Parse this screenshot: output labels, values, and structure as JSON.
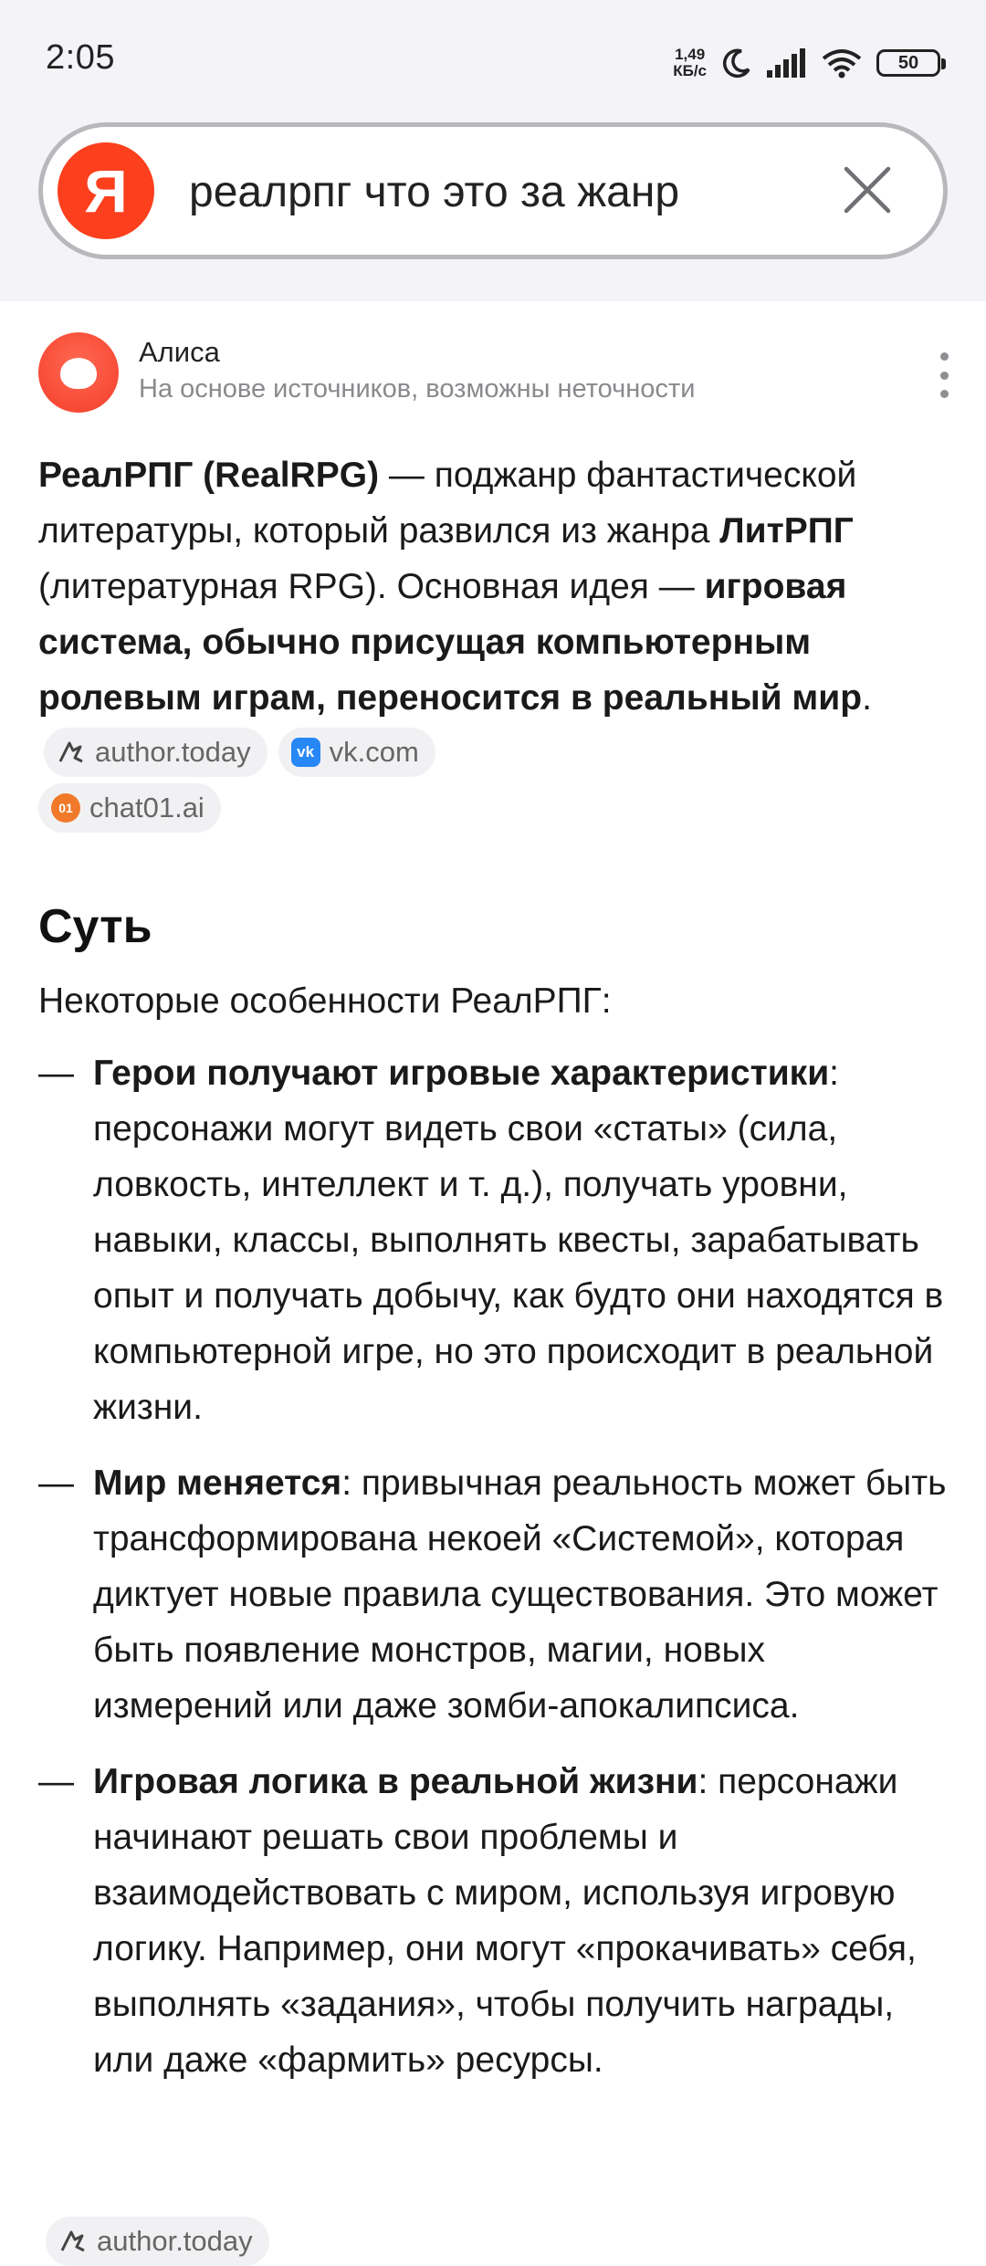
{
  "status_bar": {
    "time": "2:05",
    "net_speed_value": "1,49",
    "net_speed_unit": "КБ/с",
    "battery": "50"
  },
  "search": {
    "logo_letter": "Я",
    "query": "реалрпг что это за жанр"
  },
  "alice": {
    "name": "Алиса",
    "note": "На основе источников, возможны неточности"
  },
  "answer": {
    "p1_bold": "РеалРПГ (RealRPG)",
    "p1_text": " — поджанр фантастической литературы, который развился из жанра ",
    "p1_bold2": "ЛитРПГ",
    "p1_text2": " (литературная RPG). Основная идея — ",
    "p1_bold3": "игровая система, обычно присущая компьютерным ролевым играм, переносится в реальный мир",
    "p1_end": ".",
    "sources": [
      {
        "label": "author.today",
        "icon": "author-today-icon"
      },
      {
        "label": "vk.com",
        "icon": "vk-icon"
      },
      {
        "label": "chat01.ai",
        "icon": "chat01-icon"
      }
    ]
  },
  "section": {
    "title": "Суть",
    "intro": "Некоторые особенности РеалРПГ:",
    "bullets": [
      {
        "dash": "—",
        "bold": "Герои получают игровые характеристики",
        "text": ": персонажи могут видеть свои «статы» (сила, ловкость, интеллект и т. д.), получать уровни, навыки, классы, выполнять квесты, зарабатывать опыт и получать добычу, как будто они находятся в компьютерной игре, но это происходит в реальной жизни."
      },
      {
        "dash": "—",
        "bold": "Мир меняется",
        "text": ": привычная реальность может быть трансформирована некоей «Системой», которая диктует новые правила существования. Это может быть появление монстров, магии, новых измерений или даже зомби-апокалипсиса."
      },
      {
        "dash": "—",
        "bold": "Игровая логика в реальной жизни",
        "text": ": персонажи начинают решать свои проблемы и взаимодействовать с миром, используя игровую логику. Например, они могут «прокачивать» себя, выполнять «задания», чтобы получить награды, или даже «фармить» ресурсы."
      }
    ],
    "bottom_source": "author.today"
  },
  "colors": {
    "yandex_red": "#fc3f1d",
    "vk_blue": "#2787f5",
    "chip_bg": "#f1f1f3",
    "header_bg": "#f4f3f7"
  }
}
